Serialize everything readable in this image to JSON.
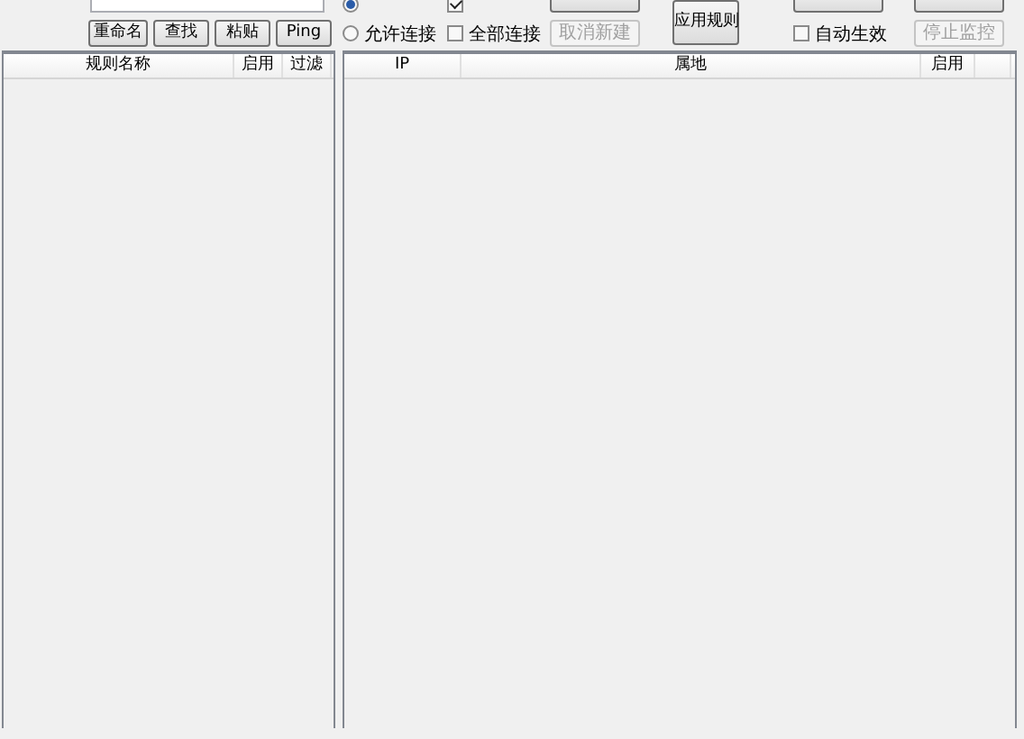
{
  "toolbar": {
    "radios": [
      {
        "selected": true
      },
      {
        "label": "允许连接",
        "selected": false
      }
    ],
    "checkboxes": [
      {
        "checked": true
      },
      {
        "label": "全部连接",
        "checked": false
      },
      {
        "label": "自动生效",
        "checked": false
      }
    ],
    "buttons": [
      {
        "label": "重命名",
        "disabled": false
      },
      {
        "label": "查找",
        "disabled": false
      },
      {
        "label": "粘贴",
        "disabled": false
      },
      {
        "label": "Ping",
        "disabled": false
      },
      {
        "label": "取消新建",
        "disabled": true
      },
      {
        "label": "应用规则",
        "disabled": false
      },
      {
        "label": "停止监控",
        "disabled": true
      }
    ]
  },
  "rules_table": {
    "columns": [
      "规则名称",
      "启用",
      "过滤"
    ]
  },
  "ip_table": {
    "columns": [
      "IP",
      "属地",
      "启用"
    ]
  }
}
